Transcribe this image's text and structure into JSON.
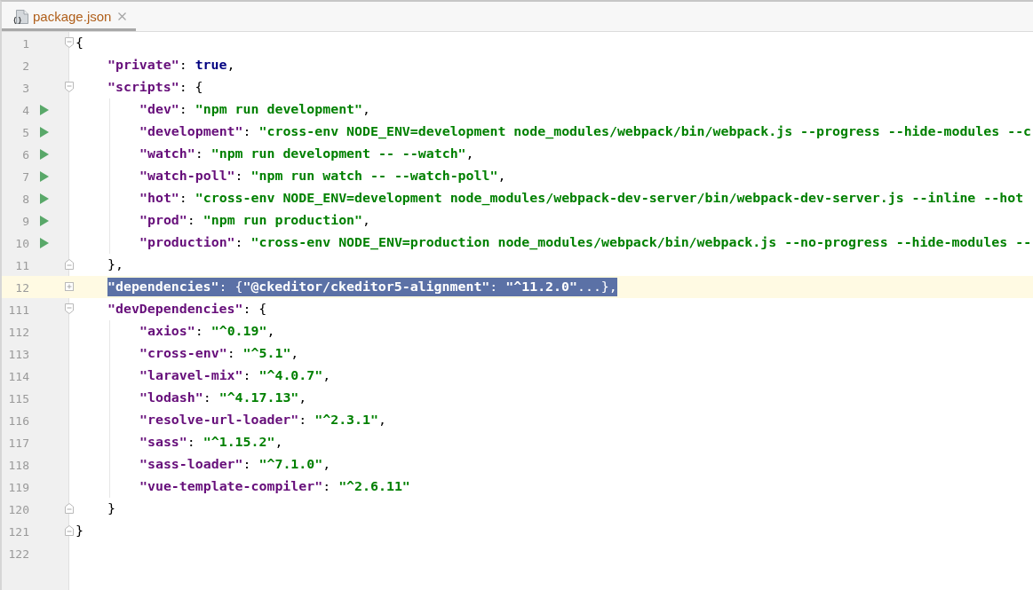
{
  "tabs": [
    {
      "label": "package.json",
      "selected": true
    }
  ],
  "editor": {
    "lines": [
      {
        "number": "1",
        "kind": "block-start",
        "runnable": false,
        "current": false,
        "selected": false,
        "tokens": [
          {
            "kind": "punct",
            "text": "{"
          }
        ],
        "children": [
          {
            "number": "2",
            "kind": "plain",
            "runnable": false,
            "current": false,
            "selected": false,
            "tokens": [
              {
                "kind": "key",
                "text": "\"private\""
              },
              {
                "kind": "punct",
                "text": ": "
              },
              {
                "kind": "keyword",
                "text": "true"
              },
              {
                "kind": "punct",
                "text": ","
              }
            ]
          },
          {
            "number": "3",
            "kind": "block-start",
            "runnable": false,
            "current": false,
            "selected": false,
            "tokens": [
              {
                "kind": "key",
                "text": "\"scripts\""
              },
              {
                "kind": "punct",
                "text": ": {"
              }
            ],
            "children": [
              {
                "number": "4",
                "kind": "plain",
                "runnable": true,
                "current": false,
                "selected": false,
                "tokens": [
                  {
                    "kind": "key",
                    "text": "\"dev\""
                  },
                  {
                    "kind": "punct",
                    "text": ": "
                  },
                  {
                    "kind": "string",
                    "text": "\"npm run development\""
                  },
                  {
                    "kind": "punct",
                    "text": ","
                  }
                ]
              },
              {
                "number": "5",
                "kind": "plain",
                "runnable": true,
                "current": false,
                "selected": false,
                "tokens": [
                  {
                    "kind": "key",
                    "text": "\"development\""
                  },
                  {
                    "kind": "punct",
                    "text": ": "
                  },
                  {
                    "kind": "string",
                    "text": "\"cross-env NODE_ENV=development node_modules/webpack/bin/webpack.js --progress --hide-modules --c"
                  }
                ]
              },
              {
                "number": "6",
                "kind": "plain",
                "runnable": true,
                "current": false,
                "selected": false,
                "tokens": [
                  {
                    "kind": "key",
                    "text": "\"watch\""
                  },
                  {
                    "kind": "punct",
                    "text": ": "
                  },
                  {
                    "kind": "string",
                    "text": "\"npm run development -- --watch\""
                  },
                  {
                    "kind": "punct",
                    "text": ","
                  }
                ]
              },
              {
                "number": "7",
                "kind": "plain",
                "runnable": true,
                "current": false,
                "selected": false,
                "tokens": [
                  {
                    "kind": "key",
                    "text": "\"watch-poll\""
                  },
                  {
                    "kind": "punct",
                    "text": ": "
                  },
                  {
                    "kind": "string",
                    "text": "\"npm run watch -- --watch-poll\""
                  },
                  {
                    "kind": "punct",
                    "text": ","
                  }
                ]
              },
              {
                "number": "8",
                "kind": "plain",
                "runnable": true,
                "current": false,
                "selected": false,
                "tokens": [
                  {
                    "kind": "key",
                    "text": "\"hot\""
                  },
                  {
                    "kind": "punct",
                    "text": ": "
                  },
                  {
                    "kind": "string",
                    "text": "\"cross-env NODE_ENV=development node_modules/webpack-dev-server/bin/webpack-dev-server.js --inline --hot"
                  }
                ]
              },
              {
                "number": "9",
                "kind": "plain",
                "runnable": true,
                "current": false,
                "selected": false,
                "tokens": [
                  {
                    "kind": "key",
                    "text": "\"prod\""
                  },
                  {
                    "kind": "punct",
                    "text": ": "
                  },
                  {
                    "kind": "string",
                    "text": "\"npm run production\""
                  },
                  {
                    "kind": "punct",
                    "text": ","
                  }
                ]
              },
              {
                "number": "10",
                "kind": "plain",
                "runnable": true,
                "current": false,
                "selected": false,
                "tokens": [
                  {
                    "kind": "key",
                    "text": "\"production\""
                  },
                  {
                    "kind": "punct",
                    "text": ": "
                  },
                  {
                    "kind": "string",
                    "text": "\"cross-env NODE_ENV=production node_modules/webpack/bin/webpack.js --no-progress --hide-modules --"
                  }
                ]
              }
            ]
          },
          {
            "number": "11",
            "kind": "block-end",
            "runnable": false,
            "current": false,
            "selected": false,
            "tokens": [
              {
                "kind": "punct",
                "text": "},"
              }
            ]
          },
          {
            "number": "12",
            "kind": "folded",
            "runnable": false,
            "current": true,
            "selected": true,
            "tokens": [
              {
                "kind": "key",
                "text": "\"dependencies\""
              },
              {
                "kind": "punct",
                "text": ": {"
              },
              {
                "kind": "key",
                "text": "\"@ckeditor/ckeditor5-alignment\""
              },
              {
                "kind": "punct",
                "text": ": "
              },
              {
                "kind": "string",
                "text": "\"^11.2.0\""
              },
              {
                "kind": "punct",
                "text": "...},"
              }
            ]
          },
          {
            "number": "111",
            "kind": "block-start",
            "runnable": false,
            "current": false,
            "selected": false,
            "tokens": [
              {
                "kind": "key",
                "text": "\"devDependencies\""
              },
              {
                "kind": "punct",
                "text": ": {"
              }
            ],
            "children": [
              {
                "number": "112",
                "kind": "plain",
                "runnable": false,
                "current": false,
                "selected": false,
                "tokens": [
                  {
                    "kind": "key",
                    "text": "\"axios\""
                  },
                  {
                    "kind": "punct",
                    "text": ": "
                  },
                  {
                    "kind": "string",
                    "text": "\"^0.19\""
                  },
                  {
                    "kind": "punct",
                    "text": ","
                  }
                ]
              },
              {
                "number": "113",
                "kind": "plain",
                "runnable": false,
                "current": false,
                "selected": false,
                "tokens": [
                  {
                    "kind": "key",
                    "text": "\"cross-env\""
                  },
                  {
                    "kind": "punct",
                    "text": ": "
                  },
                  {
                    "kind": "string",
                    "text": "\"^5.1\""
                  },
                  {
                    "kind": "punct",
                    "text": ","
                  }
                ]
              },
              {
                "number": "114",
                "kind": "plain",
                "runnable": false,
                "current": false,
                "selected": false,
                "tokens": [
                  {
                    "kind": "key",
                    "text": "\"laravel-mix\""
                  },
                  {
                    "kind": "punct",
                    "text": ": "
                  },
                  {
                    "kind": "string",
                    "text": "\"^4.0.7\""
                  },
                  {
                    "kind": "punct",
                    "text": ","
                  }
                ]
              },
              {
                "number": "115",
                "kind": "plain",
                "runnable": false,
                "current": false,
                "selected": false,
                "tokens": [
                  {
                    "kind": "key",
                    "text": "\"lodash\""
                  },
                  {
                    "kind": "punct",
                    "text": ": "
                  },
                  {
                    "kind": "string",
                    "text": "\"^4.17.13\""
                  },
                  {
                    "kind": "punct",
                    "text": ","
                  }
                ]
              },
              {
                "number": "116",
                "kind": "plain",
                "runnable": false,
                "current": false,
                "selected": false,
                "tokens": [
                  {
                    "kind": "key",
                    "text": "\"resolve-url-loader\""
                  },
                  {
                    "kind": "punct",
                    "text": ": "
                  },
                  {
                    "kind": "string",
                    "text": "\"^2.3.1\""
                  },
                  {
                    "kind": "punct",
                    "text": ","
                  }
                ]
              },
              {
                "number": "117",
                "kind": "plain",
                "runnable": false,
                "current": false,
                "selected": false,
                "tokens": [
                  {
                    "kind": "key",
                    "text": "\"sass\""
                  },
                  {
                    "kind": "punct",
                    "text": ": "
                  },
                  {
                    "kind": "string",
                    "text": "\"^1.15.2\""
                  },
                  {
                    "kind": "punct",
                    "text": ","
                  }
                ]
              },
              {
                "number": "118",
                "kind": "plain",
                "runnable": false,
                "current": false,
                "selected": false,
                "tokens": [
                  {
                    "kind": "key",
                    "text": "\"sass-loader\""
                  },
                  {
                    "kind": "punct",
                    "text": ": "
                  },
                  {
                    "kind": "string",
                    "text": "\"^7.1.0\""
                  },
                  {
                    "kind": "punct",
                    "text": ","
                  }
                ]
              },
              {
                "number": "119",
                "kind": "plain",
                "runnable": false,
                "current": false,
                "selected": false,
                "tokens": [
                  {
                    "kind": "key",
                    "text": "\"vue-template-compiler\""
                  },
                  {
                    "kind": "punct",
                    "text": ": "
                  },
                  {
                    "kind": "string",
                    "text": "\"^2.6.11\""
                  }
                ]
              }
            ]
          },
          {
            "number": "120",
            "kind": "block-end",
            "runnable": false,
            "current": false,
            "selected": false,
            "tokens": [
              {
                "kind": "punct",
                "text": "}"
              }
            ]
          }
        ]
      },
      {
        "number": "121",
        "kind": "block-end",
        "runnable": false,
        "current": false,
        "selected": false,
        "tokens": [
          {
            "kind": "punct",
            "text": "}"
          }
        ]
      },
      {
        "number": "122",
        "kind": "plain",
        "runnable": false,
        "current": false,
        "selected": false
      }
    ]
  }
}
